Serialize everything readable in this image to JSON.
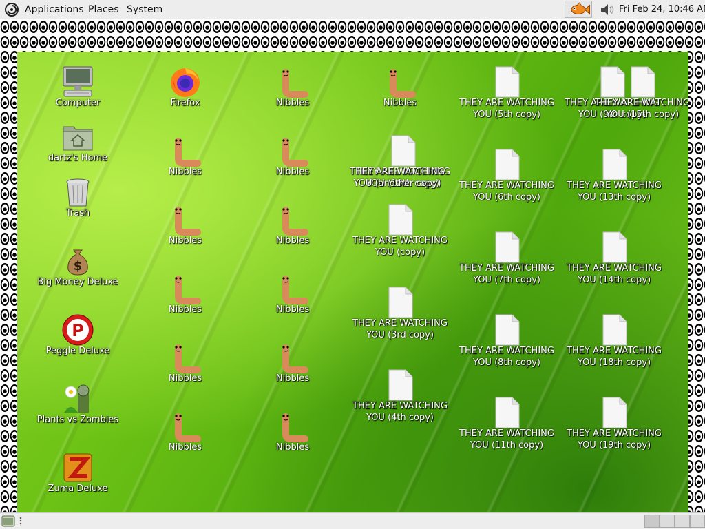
{
  "top_panel": {
    "menus": [
      "Applications",
      "Places",
      "System"
    ],
    "clock": "Fri Feb 24, 10:46 AM",
    "tray_icons": [
      "fish-applet-icon",
      "volume-icon"
    ]
  },
  "desktop": {
    "icons": [
      {
        "label": "Computer",
        "icon": "computer-icon"
      },
      {
        "label": "dartz's Home",
        "icon": "home-folder-icon"
      },
      {
        "label": "Trash",
        "icon": "trash-icon"
      },
      {
        "label": "Big Money Deluxe",
        "icon": "money-bag-icon"
      },
      {
        "label": "Peggle Deluxe",
        "icon": "peggle-icon"
      },
      {
        "label": "Plants vs Zombies",
        "icon": "plants-vs-zombies-icon"
      },
      {
        "label": "Zuma Deluxe",
        "icon": "zuma-icon"
      },
      {
        "label": "Firefox",
        "icon": "firefox-icon"
      },
      {
        "label": "Nibbles",
        "icon": "worm-icon"
      },
      {
        "label": "Nibbles",
        "icon": "worm-icon"
      },
      {
        "label": "Nibbles",
        "icon": "worm-icon"
      },
      {
        "label": "Nibbles",
        "icon": "worm-icon"
      },
      {
        "label": "Nibbles",
        "icon": "worm-icon"
      },
      {
        "label": "Nibbles",
        "icon": "worm-icon"
      },
      {
        "label": "Nibbles",
        "icon": "worm-icon"
      },
      {
        "label": "Nibbles",
        "icon": "worm-icon"
      },
      {
        "label": "Nibbles",
        "icon": "worm-icon"
      },
      {
        "label": "Nibbles",
        "icon": "worm-icon"
      },
      {
        "label": "Nibbles",
        "icon": "worm-icon"
      },
      {
        "label": "Nibbles",
        "icon": "worm-icon"
      },
      {
        "label": "THEY ARE WATCHING YOU (10th copy)",
        "icon": "document-icon"
      },
      {
        "label": "THEY ARE WATCHING YOU (another copy)",
        "icon": "document-icon"
      },
      {
        "label": "THEY ARE WATCHING YOU (copy)",
        "icon": "document-icon"
      },
      {
        "label": "THEY ARE WATCHING YOU (3rd copy)",
        "icon": "document-icon"
      },
      {
        "label": "THEY ARE WATCHING YOU (4th copy)",
        "icon": "document-icon"
      },
      {
        "label": "THEY ARE WATCHING YOU (5th copy)",
        "icon": "document-icon"
      },
      {
        "label": "THEY ARE WATCHING YOU (6th copy)",
        "icon": "document-icon"
      },
      {
        "label": "THEY ARE WATCHING YOU (7th copy)",
        "icon": "document-icon"
      },
      {
        "label": "THEY ARE WATCHING YOU (8th copy)",
        "icon": "document-icon"
      },
      {
        "label": "THEY ARE WATCHING YOU (11th copy)",
        "icon": "document-icon"
      },
      {
        "label": "THEY ARE WATCHING YOU (9th copy)",
        "icon": "document-icon"
      },
      {
        "label": "THEY ARE WATCHING YOU (15th copy)",
        "icon": "document-icon"
      },
      {
        "label": "THEY ARE WATCHING YOU (13th copy)",
        "icon": "document-icon"
      },
      {
        "label": "THEY ARE WATCHING YOU (14th copy)",
        "icon": "document-icon"
      },
      {
        "label": "THEY ARE WATCHING YOU (18th copy)",
        "icon": "document-icon"
      },
      {
        "label": "THEY ARE WATCHING YOU (19th copy)",
        "icon": "document-icon"
      }
    ]
  },
  "bottom_panel": {
    "workspace_count": 4
  }
}
